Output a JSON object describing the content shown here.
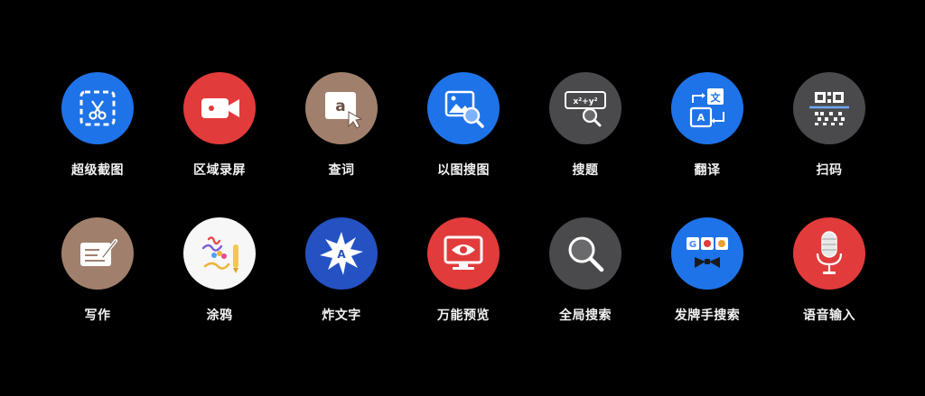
{
  "tools": [
    {
      "label": "超级截图",
      "icon": "screenshot-icon",
      "color": "#1f73e8"
    },
    {
      "label": "区域录屏",
      "icon": "video-camera-icon",
      "color": "#e23b3b"
    },
    {
      "label": "查词",
      "icon": "dictionary-icon",
      "color": "#a0806c"
    },
    {
      "label": "以图搜图",
      "icon": "image-search-icon",
      "color": "#1f73e8"
    },
    {
      "label": "搜题",
      "icon": "formula-search-icon",
      "color": "#4a4a4c"
    },
    {
      "label": "翻译",
      "icon": "translate-icon",
      "color": "#1f73e8"
    },
    {
      "label": "扫码",
      "icon": "qr-scan-icon",
      "color": "#4a4a4c"
    },
    {
      "label": "写作",
      "icon": "writing-icon",
      "color": "#a0806c"
    },
    {
      "label": "涂鸦",
      "icon": "doodle-icon",
      "color": "#f7f7f7"
    },
    {
      "label": "炸文字",
      "icon": "text-burst-icon",
      "color": "#2452c2"
    },
    {
      "label": "万能预览",
      "icon": "eye-preview-icon",
      "color": "#e23b3b"
    },
    {
      "label": "全局搜索",
      "icon": "magnifier-icon",
      "color": "#4a4a4c"
    },
    {
      "label": "发牌手搜索",
      "icon": "dealer-search-icon",
      "color": "#1f73e8"
    },
    {
      "label": "语音输入",
      "icon": "microphone-icon",
      "color": "#e23b3b"
    }
  ]
}
